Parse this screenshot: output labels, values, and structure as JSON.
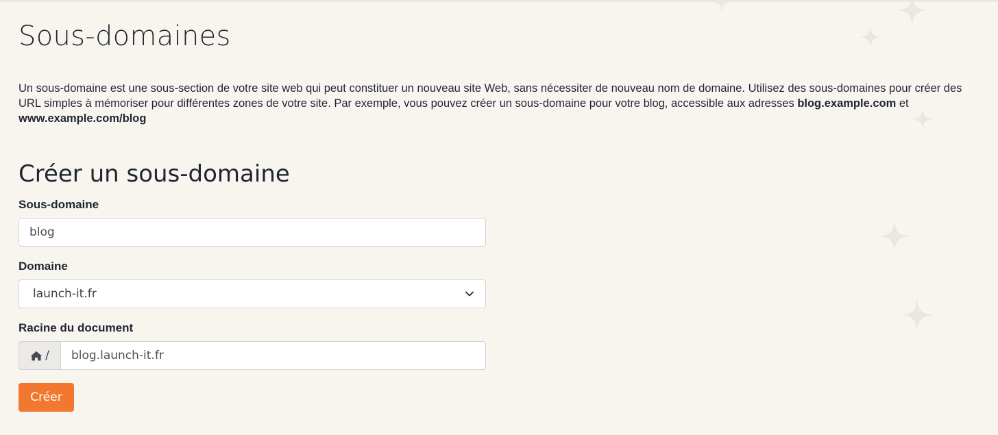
{
  "header": {
    "title": "Sous-domaines"
  },
  "intro": {
    "text": "Un sous-domaine est une sous-section de votre site web qui peut constituer un nouveau site Web, sans nécessiter de nouveau nom de domaine. Utilisez des sous-domaines pour créer des URL simples à mémoriser pour différentes zones de votre site. Par exemple, vous pouvez créer un sous-domaine pour votre blog, accessible aux adresses ",
    "example_1": "blog.example.com",
    "connector": " et ",
    "example_2": "www.example.com/blog"
  },
  "form": {
    "title": "Créer un sous-domaine",
    "subdomain": {
      "label": "Sous-domaine",
      "value": "blog"
    },
    "domain": {
      "label": "Domaine",
      "selected": "launch-it.fr"
    },
    "document_root": {
      "label": "Racine du document",
      "prefix": "/",
      "prefix_icon": "home-icon",
      "value": "blog.launch-it.fr"
    },
    "submit_label": "Créer"
  },
  "colors": {
    "background": "#f8f5ef",
    "accent": "#f3782f",
    "text": "#1f2533"
  }
}
